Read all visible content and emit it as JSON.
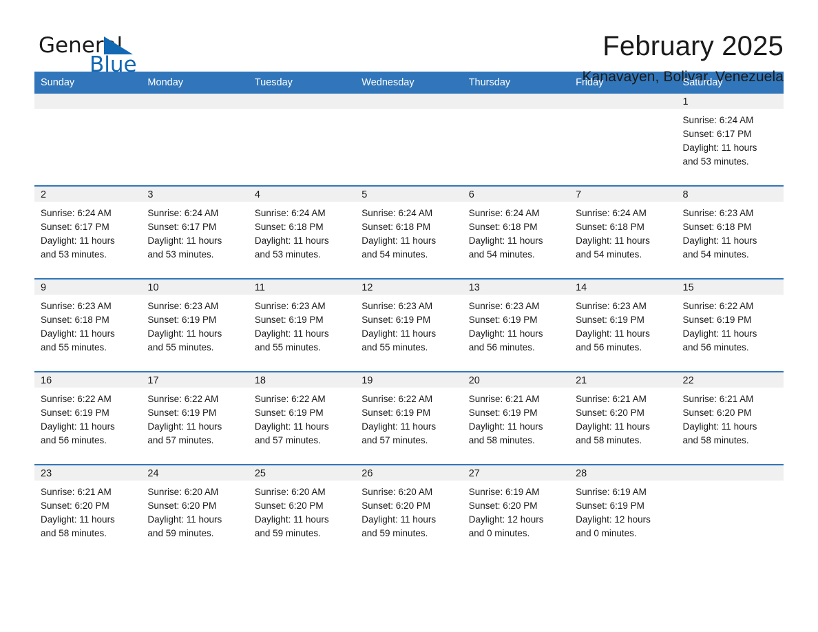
{
  "brand": {
    "name_part1": "General",
    "name_part2": "Blue",
    "triangle_color": "#1268b3",
    "text_color": "#1b1b1b"
  },
  "header": {
    "month_title": "February 2025",
    "location": "Kanavayen, Bolivar, Venezuela"
  },
  "theme": {
    "header_blue": "#3176ba",
    "daynum_band": "#f0f0f0",
    "row_divider": "#3176ba",
    "text": "#1a1a1a"
  },
  "weekday_headers": [
    "Sunday",
    "Monday",
    "Tuesday",
    "Wednesday",
    "Thursday",
    "Friday",
    "Saturday"
  ],
  "weeks": [
    [
      {
        "day": "",
        "blank": true
      },
      {
        "day": "",
        "blank": true
      },
      {
        "day": "",
        "blank": true
      },
      {
        "day": "",
        "blank": true
      },
      {
        "day": "",
        "blank": true
      },
      {
        "day": "",
        "blank": true
      },
      {
        "day": "1",
        "sunrise": "Sunrise: 6:24 AM",
        "sunset": "Sunset: 6:17 PM",
        "daylight_line1": "Daylight: 11 hours",
        "daylight_line2": "and 53 minutes."
      }
    ],
    [
      {
        "day": "2",
        "sunrise": "Sunrise: 6:24 AM",
        "sunset": "Sunset: 6:17 PM",
        "daylight_line1": "Daylight: 11 hours",
        "daylight_line2": "and 53 minutes."
      },
      {
        "day": "3",
        "sunrise": "Sunrise: 6:24 AM",
        "sunset": "Sunset: 6:17 PM",
        "daylight_line1": "Daylight: 11 hours",
        "daylight_line2": "and 53 minutes."
      },
      {
        "day": "4",
        "sunrise": "Sunrise: 6:24 AM",
        "sunset": "Sunset: 6:18 PM",
        "daylight_line1": "Daylight: 11 hours",
        "daylight_line2": "and 53 minutes."
      },
      {
        "day": "5",
        "sunrise": "Sunrise: 6:24 AM",
        "sunset": "Sunset: 6:18 PM",
        "daylight_line1": "Daylight: 11 hours",
        "daylight_line2": "and 54 minutes."
      },
      {
        "day": "6",
        "sunrise": "Sunrise: 6:24 AM",
        "sunset": "Sunset: 6:18 PM",
        "daylight_line1": "Daylight: 11 hours",
        "daylight_line2": "and 54 minutes."
      },
      {
        "day": "7",
        "sunrise": "Sunrise: 6:24 AM",
        "sunset": "Sunset: 6:18 PM",
        "daylight_line1": "Daylight: 11 hours",
        "daylight_line2": "and 54 minutes."
      },
      {
        "day": "8",
        "sunrise": "Sunrise: 6:23 AM",
        "sunset": "Sunset: 6:18 PM",
        "daylight_line1": "Daylight: 11 hours",
        "daylight_line2": "and 54 minutes."
      }
    ],
    [
      {
        "day": "9",
        "sunrise": "Sunrise: 6:23 AM",
        "sunset": "Sunset: 6:18 PM",
        "daylight_line1": "Daylight: 11 hours",
        "daylight_line2": "and 55 minutes."
      },
      {
        "day": "10",
        "sunrise": "Sunrise: 6:23 AM",
        "sunset": "Sunset: 6:19 PM",
        "daylight_line1": "Daylight: 11 hours",
        "daylight_line2": "and 55 minutes."
      },
      {
        "day": "11",
        "sunrise": "Sunrise: 6:23 AM",
        "sunset": "Sunset: 6:19 PM",
        "daylight_line1": "Daylight: 11 hours",
        "daylight_line2": "and 55 minutes."
      },
      {
        "day": "12",
        "sunrise": "Sunrise: 6:23 AM",
        "sunset": "Sunset: 6:19 PM",
        "daylight_line1": "Daylight: 11 hours",
        "daylight_line2": "and 55 minutes."
      },
      {
        "day": "13",
        "sunrise": "Sunrise: 6:23 AM",
        "sunset": "Sunset: 6:19 PM",
        "daylight_line1": "Daylight: 11 hours",
        "daylight_line2": "and 56 minutes."
      },
      {
        "day": "14",
        "sunrise": "Sunrise: 6:23 AM",
        "sunset": "Sunset: 6:19 PM",
        "daylight_line1": "Daylight: 11 hours",
        "daylight_line2": "and 56 minutes."
      },
      {
        "day": "15",
        "sunrise": "Sunrise: 6:22 AM",
        "sunset": "Sunset: 6:19 PM",
        "daylight_line1": "Daylight: 11 hours",
        "daylight_line2": "and 56 minutes."
      }
    ],
    [
      {
        "day": "16",
        "sunrise": "Sunrise: 6:22 AM",
        "sunset": "Sunset: 6:19 PM",
        "daylight_line1": "Daylight: 11 hours",
        "daylight_line2": "and 56 minutes."
      },
      {
        "day": "17",
        "sunrise": "Sunrise: 6:22 AM",
        "sunset": "Sunset: 6:19 PM",
        "daylight_line1": "Daylight: 11 hours",
        "daylight_line2": "and 57 minutes."
      },
      {
        "day": "18",
        "sunrise": "Sunrise: 6:22 AM",
        "sunset": "Sunset: 6:19 PM",
        "daylight_line1": "Daylight: 11 hours",
        "daylight_line2": "and 57 minutes."
      },
      {
        "day": "19",
        "sunrise": "Sunrise: 6:22 AM",
        "sunset": "Sunset: 6:19 PM",
        "daylight_line1": "Daylight: 11 hours",
        "daylight_line2": "and 57 minutes."
      },
      {
        "day": "20",
        "sunrise": "Sunrise: 6:21 AM",
        "sunset": "Sunset: 6:19 PM",
        "daylight_line1": "Daylight: 11 hours",
        "daylight_line2": "and 58 minutes."
      },
      {
        "day": "21",
        "sunrise": "Sunrise: 6:21 AM",
        "sunset": "Sunset: 6:20 PM",
        "daylight_line1": "Daylight: 11 hours",
        "daylight_line2": "and 58 minutes."
      },
      {
        "day": "22",
        "sunrise": "Sunrise: 6:21 AM",
        "sunset": "Sunset: 6:20 PM",
        "daylight_line1": "Daylight: 11 hours",
        "daylight_line2": "and 58 minutes."
      }
    ],
    [
      {
        "day": "23",
        "sunrise": "Sunrise: 6:21 AM",
        "sunset": "Sunset: 6:20 PM",
        "daylight_line1": "Daylight: 11 hours",
        "daylight_line2": "and 58 minutes."
      },
      {
        "day": "24",
        "sunrise": "Sunrise: 6:20 AM",
        "sunset": "Sunset: 6:20 PM",
        "daylight_line1": "Daylight: 11 hours",
        "daylight_line2": "and 59 minutes."
      },
      {
        "day": "25",
        "sunrise": "Sunrise: 6:20 AM",
        "sunset": "Sunset: 6:20 PM",
        "daylight_line1": "Daylight: 11 hours",
        "daylight_line2": "and 59 minutes."
      },
      {
        "day": "26",
        "sunrise": "Sunrise: 6:20 AM",
        "sunset": "Sunset: 6:20 PM",
        "daylight_line1": "Daylight: 11 hours",
        "daylight_line2": "and 59 minutes."
      },
      {
        "day": "27",
        "sunrise": "Sunrise: 6:19 AM",
        "sunset": "Sunset: 6:20 PM",
        "daylight_line1": "Daylight: 12 hours",
        "daylight_line2": "and 0 minutes."
      },
      {
        "day": "28",
        "sunrise": "Sunrise: 6:19 AM",
        "sunset": "Sunset: 6:19 PM",
        "daylight_line1": "Daylight: 12 hours",
        "daylight_line2": "and 0 minutes."
      },
      {
        "day": "",
        "blank": true
      }
    ]
  ]
}
